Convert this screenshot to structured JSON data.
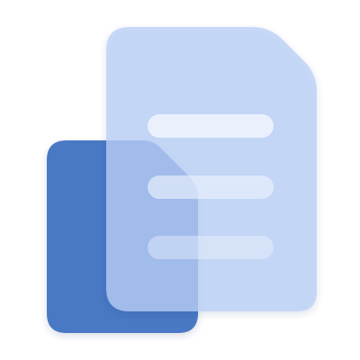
{
  "icon": {
    "name": "copy-documents-icon",
    "colors": {
      "front_doc": "#4a78c4",
      "back_doc": "#b9d0f6",
      "text_lines": "#eef3fd"
    }
  }
}
